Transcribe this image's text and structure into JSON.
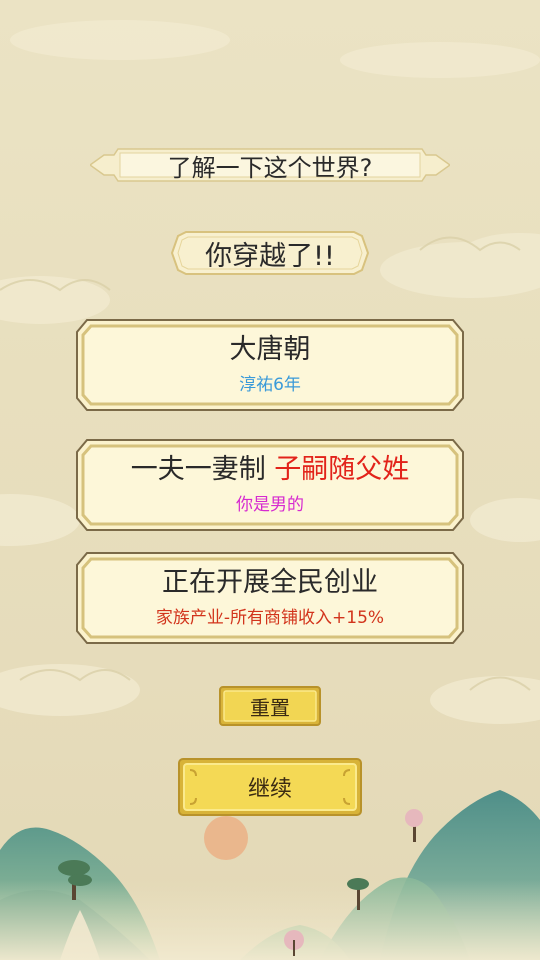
{
  "question_banner": {
    "text": "了解一下这个世界?"
  },
  "main_banner": {
    "text": "你穿越了!!"
  },
  "cards": [
    {
      "title": "大唐朝",
      "subtitle": "淳祐6年",
      "subtitle_color": "#3a9ad9"
    },
    {
      "title_main": "一夫一妻制",
      "title_accent": "子嗣随父姓",
      "title_accent_color": "#e2231a",
      "subtitle": "你是男的",
      "subtitle_color": "#d62ad0"
    },
    {
      "title": "正在开展全民创业",
      "subtitle": "家族产业-所有商铺收入+15%",
      "subtitle_color": "#d2341c"
    }
  ],
  "buttons": {
    "reset_label": "重置",
    "continue_label": "继续"
  },
  "colors": {
    "card_fill": "#fdf6d6",
    "card_border": "#c9b46f",
    "button_gold": "#f1d24a"
  }
}
